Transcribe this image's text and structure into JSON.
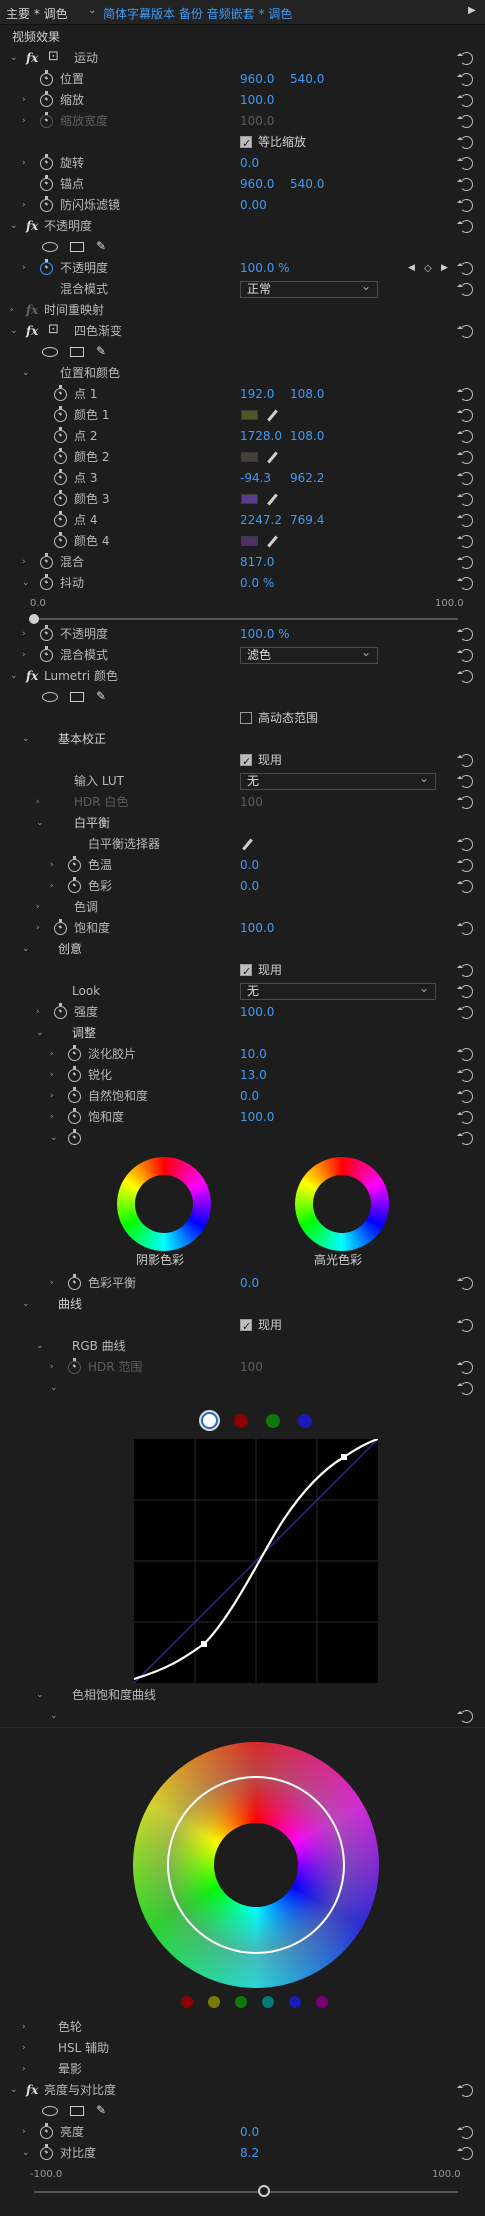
{
  "header": {
    "tab_main": "主要 * 调色",
    "tab_clip": "简体字幕版本 备份 音频嵌套 * 调色"
  },
  "section_title": "视频效果",
  "motion": {
    "name": "运动",
    "position": "位置",
    "pos_x": "960.0",
    "pos_y": "540.0",
    "scale": "缩放",
    "scale_val": "100.0",
    "scale_width": "缩放宽度",
    "scale_width_val": "100.0",
    "uniform_scale": "等比缩放",
    "rotation": "旋转",
    "rotation_val": "0.0",
    "anchor": "锚点",
    "anchor_x": "960.0",
    "anchor_y": "540.0",
    "anti_flicker": "防闪烁滤镜",
    "anti_flicker_val": "0.00"
  },
  "opacity": {
    "name": "不透明度",
    "opacity": "不透明度",
    "opacity_val": "100.0 %",
    "blend": "混合模式",
    "blend_val": "正常"
  },
  "time_remap": {
    "name": "时间重映射"
  },
  "four_color": {
    "name": "四色渐变",
    "pos_color": "位置和颜色",
    "p1": "点 1",
    "p1x": "192.0",
    "p1y": "108.0",
    "c1": "颜色 1",
    "p2": "点 2",
    "p2x": "1728.0",
    "p2y": "108.0",
    "c2": "颜色 2",
    "p3": "点 3",
    "p3x": "-94.3",
    "p3y": "962.2",
    "c3": "颜色 3",
    "p4": "点 4",
    "p4x": "2247.2",
    "p4y": "769.4",
    "c4": "颜色 4",
    "blend": "混合",
    "blend_val": "817.0",
    "jitter": "抖动",
    "jitter_val": "0.0 %",
    "slider_min": "0.0",
    "slider_max": "100.0",
    "opacity": "不透明度",
    "opacity_val": "100.0 %",
    "blend_mode": "混合模式",
    "blend_mode_val": "滤色"
  },
  "lumetri": {
    "name": "Lumetri 颜色",
    "hdr": "高动态范围",
    "basic": "基本校正",
    "enable": "现用",
    "input_lut": "输入 LUT",
    "input_lut_val": "无",
    "hdr_white": "HDR 白色",
    "hdr_white_val": "100",
    "wb": "白平衡",
    "wb_picker": "白平衡选择器",
    "temp": "色温",
    "temp_val": "0.0",
    "tint": "色彩",
    "tint_val": "0.0",
    "tone": "色调",
    "sat": "饱和度",
    "sat_val": "100.0",
    "creative": "创意",
    "enable2": "现用",
    "look": "Look",
    "look_val": "无",
    "intensity": "强度",
    "intensity_val": "100.0",
    "adjust": "调整",
    "faded": "淡化胶片",
    "faded_val": "10.0",
    "sharpen": "锐化",
    "sharpen_val": "13.0",
    "vibrance": "自然饱和度",
    "vibrance_val": "0.0",
    "saturation": "饱和度",
    "saturation_val": "100.0",
    "shadow_tint": "阴影色彩",
    "highlight_tint": "高光色彩",
    "tint_balance": "色彩平衡",
    "tint_balance_val": "0.0",
    "curves": "曲线",
    "enable3": "现用",
    "rgb_curves": "RGB 曲线",
    "hdr_range": "HDR 范围",
    "hdr_range_val": "100",
    "hue_sat": "色相饱和度曲线",
    "color_wheels": "色轮",
    "hsl": "HSL 辅助",
    "vignette": "晕影"
  },
  "bc": {
    "name": "亮度与对比度",
    "brightness": "亮度",
    "brightness_val": "0.0",
    "contrast": "对比度",
    "contrast_val": "8.2",
    "slider_min": "-100.0",
    "slider_max": "100.0"
  },
  "colors": {
    "accent": "#3f9bf5",
    "bg": "#1d1d1d",
    "c1": "#4c5a22",
    "c2": "#46403a",
    "c3": "#5a3d8c",
    "c4": "#4e2e63"
  }
}
